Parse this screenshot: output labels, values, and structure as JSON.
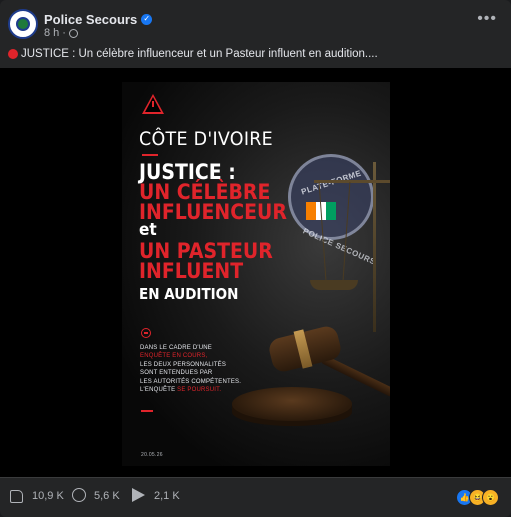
{
  "post": {
    "page_name": "Police Secours",
    "time": "8 h",
    "caption": "JUSTICE : Un célèbre influenceur et un Pasteur influent en audition...."
  },
  "poster": {
    "country": "CÔTE D'IVOIRE",
    "headline": {
      "line1": "JUSTICE :",
      "line2": "UN CÉLÈBRE",
      "line3": "INFLUENCEUR",
      "line4": "et",
      "line5": "UN PASTEUR",
      "line6": "INFLUENT",
      "line7": "EN AUDITION"
    },
    "body": {
      "l1": "DANS LE CADRE D'UNE",
      "l2_red": "ENQUÊTE EN COURS,",
      "l3": "LES DEUX PERSONNALITÉS",
      "l4": "SONT ENTENDUES PAR",
      "l5": "LES AUTORITÉS COMPÉTENTES.",
      "l6_a": "L'ENQUÊTE ",
      "l6_red": "SE POURSUIT."
    },
    "date": "20.05.26",
    "seal_top": "PLATE-FORME",
    "seal_bottom": "POLICE SECOURS"
  },
  "footer": {
    "likes": "10,9 K",
    "comments": "5,6 K",
    "shares": "2,1 K"
  },
  "colors": {
    "accent_red": "#e0242b",
    "facebook_blue": "#1877f2",
    "background": "#242526"
  },
  "icons": {
    "verified": "verified-badge-icon",
    "globe": "globe-icon",
    "more": "more-options-icon",
    "like": "like-icon",
    "comment": "comment-icon",
    "share": "share-icon",
    "reactions": [
      "like-reaction-icon",
      "haha-reaction-icon",
      "wow-reaction-icon"
    ]
  }
}
